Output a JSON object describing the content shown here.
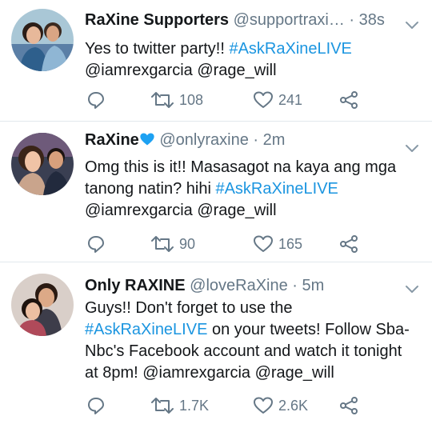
{
  "tweets": [
    {
      "name": "RaXine Supporters",
      "handle": "@supportraxi…",
      "dot": "·",
      "time": "38s",
      "text_parts": [
        "Yes to twitter party!! ",
        "#AskRaXineLIVE",
        " @iamrexgarcia @rage_will"
      ],
      "retweets": "108",
      "likes": "241"
    },
    {
      "name": "RaXine",
      "handle": "@onlyraxine",
      "dot": "·",
      "time": "2m",
      "text_parts": [
        "Omg this is it!! Masasagot na kaya ang mga tanong natin? hihi ",
        "#AskRaXineLIVE",
        " @iamrexgarcia @rage_will"
      ],
      "retweets": "90",
      "likes": "165"
    },
    {
      "name": "Only RAXINE",
      "handle": "@loveRaXine",
      "dot": "·",
      "time": "5m",
      "text_parts": [
        "Guys!! Don't forget to use the ",
        "#AskRaXineLIVE",
        " on your tweets! Follow Sba-Nbc's Facebook account and watch it tonight at 8pm! @iamrexgarcia @rage_will"
      ],
      "retweets": "1.7K",
      "likes": "2.6K"
    }
  ],
  "colors": {
    "hashtag": "#1b95e0",
    "secondary": "#657786",
    "text": "#14171a",
    "divider": "#e1e8ed",
    "heart_emoji": "#1da1f2"
  },
  "icons": [
    "reply-icon",
    "retweet-icon",
    "like-icon",
    "share-icon",
    "chevron-down-icon",
    "blue-heart-icon"
  ]
}
